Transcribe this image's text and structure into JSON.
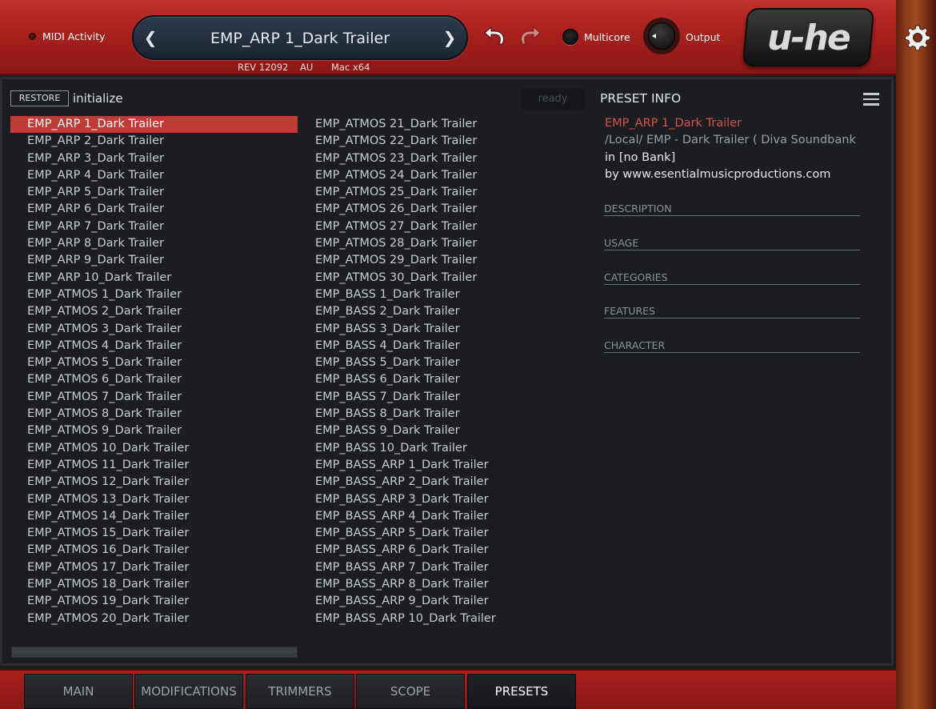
{
  "header": {
    "midi_label": "MIDI Activity",
    "preset_name": "EMP_ARP 1_Dark Trailer",
    "rev": "REV 12092",
    "format": "AU",
    "platform": "Mac x64",
    "multicore_label": "Multicore",
    "output_label": "Output",
    "logo_text": "u-he"
  },
  "browser": {
    "restore_label": "RESTORE",
    "initialize_label": "initialize",
    "status": "ready",
    "column1": [
      "EMP_ARP 1_Dark Trailer",
      "EMP_ARP 2_Dark Trailer",
      "EMP_ARP 3_Dark Trailer",
      "EMP_ARP 4_Dark Trailer",
      "EMP_ARP 5_Dark Trailer",
      "EMP_ARP 6_Dark Trailer",
      "EMP_ARP 7_Dark Trailer",
      "EMP_ARP 8_Dark Trailer",
      "EMP_ARP 9_Dark Trailer",
      "EMP_ARP 10_Dark Trailer",
      "EMP_ATMOS 1_Dark Trailer",
      "EMP_ATMOS 2_Dark Trailer",
      "EMP_ATMOS 3_Dark Trailer",
      "EMP_ATMOS 4_Dark Trailer",
      "EMP_ATMOS 5_Dark Trailer",
      "EMP_ATMOS 6_Dark Trailer",
      "EMP_ATMOS 7_Dark Trailer",
      "EMP_ATMOS 8_Dark Trailer",
      "EMP_ATMOS 9_Dark Trailer",
      "EMP_ATMOS 10_Dark Trailer",
      "EMP_ATMOS 11_Dark Trailer",
      "EMP_ATMOS 12_Dark Trailer",
      "EMP_ATMOS 13_Dark Trailer",
      "EMP_ATMOS 14_Dark Trailer",
      "EMP_ATMOS 15_Dark Trailer",
      "EMP_ATMOS 16_Dark Trailer",
      "EMP_ATMOS 17_Dark Trailer",
      "EMP_ATMOS 18_Dark Trailer",
      "EMP_ATMOS 19_Dark Trailer",
      "EMP_ATMOS 20_Dark Trailer"
    ],
    "column2": [
      "EMP_ATMOS 21_Dark Trailer",
      "EMP_ATMOS 22_Dark Trailer",
      "EMP_ATMOS 23_Dark Trailer",
      "EMP_ATMOS 24_Dark Trailer",
      "EMP_ATMOS 25_Dark Trailer",
      "EMP_ATMOS 26_Dark Trailer",
      "EMP_ATMOS 27_Dark Trailer",
      "EMP_ATMOS 28_Dark Trailer",
      "EMP_ATMOS 29_Dark Trailer",
      "EMP_ATMOS 30_Dark Trailer",
      "EMP_BASS 1_Dark Trailer",
      "EMP_BASS 2_Dark Trailer",
      "EMP_BASS 3_Dark Trailer",
      "EMP_BASS 4_Dark Trailer",
      "EMP_BASS 5_Dark Trailer",
      "EMP_BASS 6_Dark Trailer",
      "EMP_BASS 7_Dark Trailer",
      "EMP_BASS 8_Dark Trailer",
      "EMP_BASS 9_Dark Trailer",
      "EMP_BASS 10_Dark Trailer",
      "EMP_BASS_ARP 1_Dark Trailer",
      "EMP_BASS_ARP 2_Dark Trailer",
      "EMP_BASS_ARP 3_Dark Trailer",
      "EMP_BASS_ARP 4_Dark Trailer",
      "EMP_BASS_ARP 5_Dark Trailer",
      "EMP_BASS_ARP 6_Dark Trailer",
      "EMP_BASS_ARP 7_Dark Trailer",
      "EMP_BASS_ARP 8_Dark Trailer",
      "EMP_BASS_ARP 9_Dark Trailer",
      "EMP_BASS_ARP 10_Dark Trailer"
    ],
    "selected": "EMP_ARP 1_Dark Trailer"
  },
  "preset_info": {
    "title": "PRESET INFO",
    "name": "EMP_ARP 1_Dark Trailer",
    "path": "/Local/ EMP - Dark Trailer ( Diva Soundbank",
    "bank": "in [no Bank]",
    "author": "by www.esentialmusicproductions.com",
    "sections": [
      "DESCRIPTION",
      "USAGE",
      "CATEGORIES",
      "FEATURES",
      "CHARACTER"
    ]
  },
  "tabs": [
    "MAIN",
    "MODIFICATIONS",
    "TRIMMERS",
    "SCOPE",
    "PRESETS"
  ],
  "active_tab": "PRESETS",
  "colors": {
    "accent_red": "#bf3b36",
    "selected_info": "#d4544c",
    "panel_bg": "#1b1d20"
  }
}
